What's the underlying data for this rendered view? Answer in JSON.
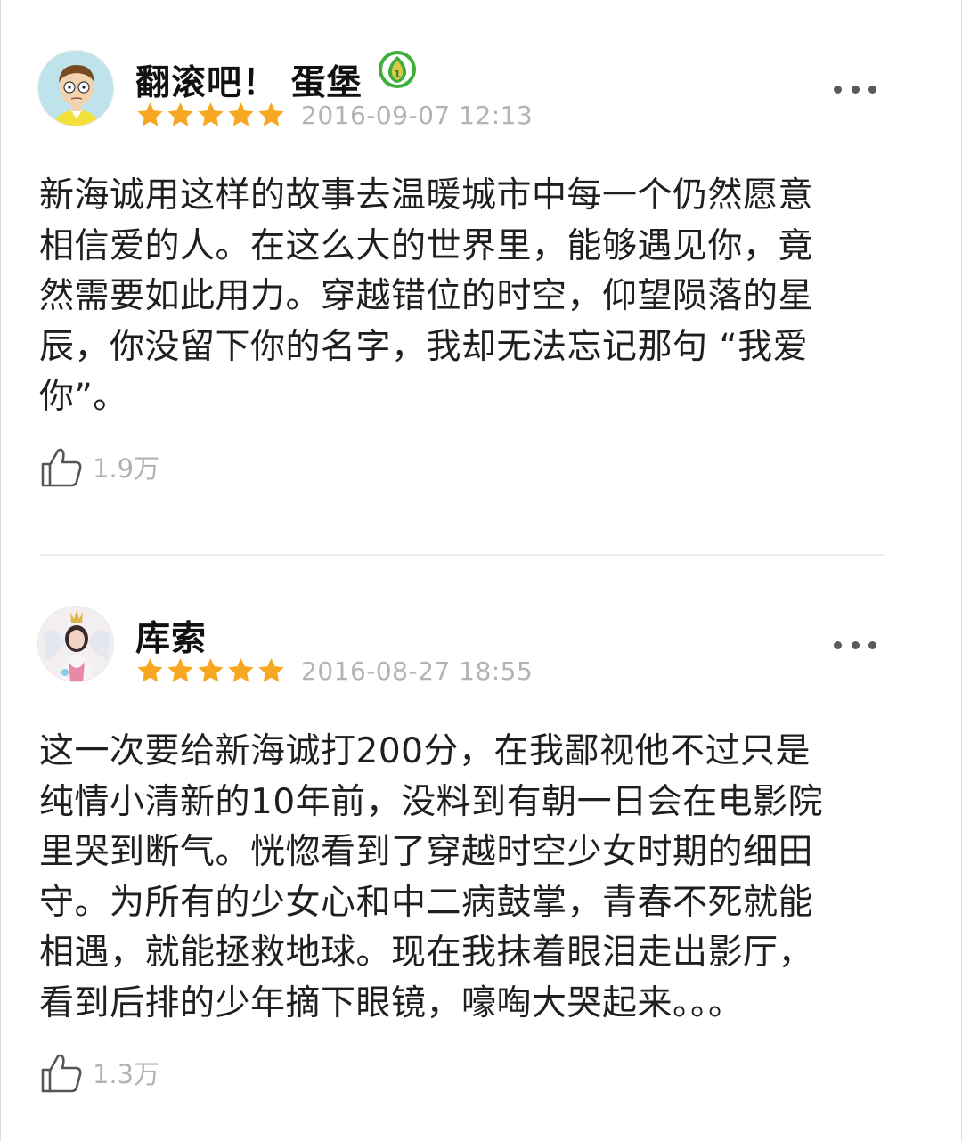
{
  "reviews": [
    {
      "username": "翻滚吧！ 蛋堡",
      "level_badge": "1",
      "rating": 5,
      "timestamp": "2016-09-07 12:13",
      "body_lines": [
        "新海诚用这样的故事去温暖城市中每一个仍然愿意",
        "相信爱的人。在这么大的世界里，能够遇见你，竟",
        "然需要如此用力。穿越错位的时空，仰望陨落的星",
        "辰，你没留下你的名字，我却无法忘记那句 “我爱",
        "你”。"
      ],
      "likes": "1.9万",
      "avatar_icon": "cartoon-avatar-icon"
    },
    {
      "username": "库索",
      "rating": 5,
      "timestamp": "2016-08-27 18:55",
      "body_lines": [
        "这一次要给新海诚打200分，在我鄙视他不过只是",
        "纯情小清新的10年前，没料到有朝一日会在电影院",
        "里哭到断气。恍惚看到了穿越时空少女时期的细田",
        "守。为所有的少女心和中二病鼓掌，青春不死就能",
        "相遇，就能拯救地球。现在我抹着眼泪走出影厅，",
        "看到后排的少年摘下眼镜，嚎啕大哭起来。。。"
      ],
      "likes": "1.3万",
      "avatar_icon": "photo-avatar-icon"
    }
  ],
  "icons": {
    "star": "star-icon",
    "more": "more-dots-icon",
    "like": "thumbs-up-icon",
    "level": "leaf-level-badge-icon"
  },
  "colors": {
    "star": "#f7a823",
    "timestamp": "#b3b3b3",
    "badge_green": "#3fae3a",
    "badge_yellow": "#d8c84a"
  }
}
